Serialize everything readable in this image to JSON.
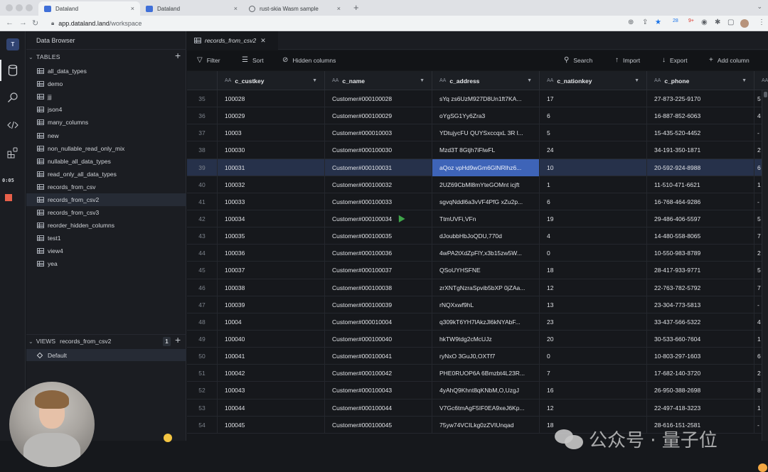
{
  "browser": {
    "tabs": [
      {
        "title": "Dataland",
        "active": true,
        "icon": "dataland-favicon"
      },
      {
        "title": "Dataland",
        "active": false,
        "icon": "dataland-favicon"
      },
      {
        "title": "rust-skia Wasm sample",
        "active": false,
        "icon": "globe-icon"
      }
    ],
    "close_glyph": "×",
    "new_tab_glyph": "+",
    "url_domain": "app.dataland.land",
    "url_path": "/workspace",
    "extension_badges": [
      "28",
      "9+"
    ]
  },
  "rail": {
    "workspace_initial": "T",
    "items": [
      "database-icon",
      "search-icon",
      "code-icon",
      "apps-icon"
    ],
    "recording_timer": "0:05",
    "record_color": "#e8604a"
  },
  "sidebar": {
    "title": "Data Browser",
    "tables_header": "TABLES",
    "tables": [
      "all_data_types",
      "demo",
      "jjj",
      "json4",
      "many_columns",
      "new",
      "non_nullable_read_only_mix",
      "nullable_all_data_types",
      "read_only_all_data_types",
      "records_from_csv",
      "records_from_csv2",
      "records_from_csv3",
      "reorder_hidden_columns",
      "test1",
      "view4",
      "yea"
    ],
    "active_table": "records_from_csv2",
    "views_header": "VIEWS",
    "views_table": "records_from_csv2",
    "views_count": "1",
    "views": [
      "Default"
    ]
  },
  "main": {
    "open_tab": "records_from_csv2",
    "toolbar": {
      "filter": "Filter",
      "sort": "Sort",
      "hidden_columns": "Hidden columns",
      "search": "Search",
      "import": "Import",
      "export": "Export",
      "add_column": "Add column"
    },
    "columns": [
      "c_custkey",
      "c_name",
      "c_address",
      "c_nationkey",
      "c_phone"
    ],
    "type_glyph": "AA",
    "rows": [
      {
        "n": "35",
        "c": [
          "100028",
          "Customer#000100028",
          "sYq zs6UzM927D8Un1ft7KA...",
          "17",
          "27-873-225-9170"
        ]
      },
      {
        "n": "36",
        "c": [
          "100029",
          "Customer#000100029",
          "oYgSG1Yy6Zra3",
          "6",
          "16-887-852-6063"
        ]
      },
      {
        "n": "37",
        "c": [
          "10003",
          "Customer#000010003",
          "YDtujycFU QUYSxccqxL 3R l...",
          "5",
          "15-435-520-4452"
        ]
      },
      {
        "n": "38",
        "c": [
          "100030",
          "Customer#000100030",
          "Mzd3T 8Gtjh7iFlwFL",
          "24",
          "34-191-350-1871"
        ]
      },
      {
        "n": "39",
        "c": [
          "100031",
          "Customer#000100031",
          "aQoz vpHd9wGm6GlNRlhz6...",
          "10",
          "20-592-924-8988"
        ],
        "selected": true
      },
      {
        "n": "40",
        "c": [
          "100032",
          "Customer#000100032",
          "2UZ69CbMl8mYteGOMnt icjft",
          "1",
          "11-510-471-6621"
        ]
      },
      {
        "n": "41",
        "c": [
          "100033",
          "Customer#000100033",
          "sgvqNddl6a3vVF4PfG xZu2p...",
          "6",
          "16-768-464-9286"
        ]
      },
      {
        "n": "42",
        "c": [
          "100034",
          "Customer#000100034",
          "TtmUVFi,VFn",
          "19",
          "29-486-406-5597"
        ]
      },
      {
        "n": "43",
        "c": [
          "100035",
          "Customer#000100035",
          "dJoubbHbJoQDU,770d",
          "4",
          "14-480-558-8065"
        ]
      },
      {
        "n": "44",
        "c": [
          "100036",
          "Customer#000100036",
          "4wPA2tXdZpFlY,x3b15zw5W...",
          "0",
          "10-550-983-8789"
        ]
      },
      {
        "n": "45",
        "c": [
          "100037",
          "Customer#000100037",
          "QSoUYHSFNE",
          "18",
          "28-417-933-9771"
        ]
      },
      {
        "n": "46",
        "c": [
          "100038",
          "Customer#000100038",
          "zrXNTgNzraSpvib5bXP 0jZAa...",
          "12",
          "22-763-782-5792"
        ]
      },
      {
        "n": "47",
        "c": [
          "100039",
          "Customer#000100039",
          "rNQXxwf9hL",
          "13",
          "23-304-773-5813"
        ]
      },
      {
        "n": "48",
        "c": [
          "10004",
          "Customer#000010004",
          "q309kT6YH7lAkzJl6kNYAbF...",
          "23",
          "33-437-566-5322"
        ]
      },
      {
        "n": "49",
        "c": [
          "100040",
          "Customer#000100040",
          "hkTW9tdg2cMcUJz",
          "20",
          "30-533-660-7604"
        ]
      },
      {
        "n": "50",
        "c": [
          "100041",
          "Customer#000100041",
          "ryNxO 3GuJ0,OXTf7",
          "0",
          "10-803-297-1603"
        ]
      },
      {
        "n": "51",
        "c": [
          "100042",
          "Customer#000100042",
          "PHE0RUOP6A 6Bmzbt4L23R...",
          "7",
          "17-682-140-3720"
        ]
      },
      {
        "n": "52",
        "c": [
          "100043",
          "Customer#000100043",
          "4yAhQ9Khnt8qKNbM,O,UzgJ",
          "16",
          "26-950-388-2698"
        ]
      },
      {
        "n": "53",
        "c": [
          "100044",
          "Customer#000100044",
          "V7Gc6tmAgF5IF0EA9xeJ6Kp...",
          "12",
          "22-497-418-3223"
        ]
      },
      {
        "n": "54",
        "c": [
          "100045",
          "Customer#000100045",
          "75yw74VCILkg0zZVIUnqad",
          "18",
          "28-616-151-2581"
        ]
      }
    ],
    "partial_column_glyphs": [
      "5",
      "4",
      "-",
      "2",
      "6",
      "1",
      "-",
      "5",
      "7",
      "2",
      "5",
      "7",
      "-",
      "4",
      "1",
      "6",
      "2",
      "8",
      "1",
      "-"
    ],
    "selection_color": "#3e64b8"
  },
  "watermark": {
    "text": "公众号 · 量子位"
  }
}
